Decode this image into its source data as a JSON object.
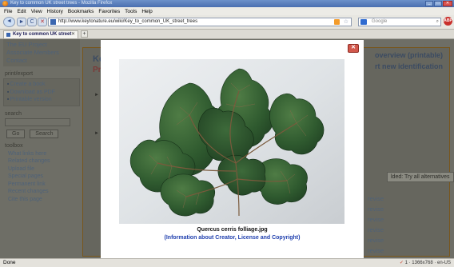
{
  "window": {
    "title": "Key to common UK street trees - Mozilla Firefox",
    "buttons": [
      "_",
      "□",
      "✕"
    ]
  },
  "menu": [
    "File",
    "Edit",
    "View",
    "History",
    "Bookmarks",
    "Favorites",
    "Tools",
    "Help"
  ],
  "nav": {
    "back": "◄",
    "forward": "►",
    "reload": "C",
    "stop": "✕",
    "home": "⌂",
    "url": "http://www.keytonature.eu/wiki/Key_to_common_UK_street_trees",
    "search_placeholder": "Google",
    "search_icon": "⌕",
    "addon_label": "ABP"
  },
  "tabs": [
    {
      "label": "Key to common UK street tr...",
      "close": "✕"
    }
  ],
  "newtab": "+",
  "sidebar": {
    "top_links": [
      "The EU Project",
      "Associate Members",
      "Contact"
    ],
    "print_heading": "print/export",
    "print_links": [
      "Create a book",
      "Download as PDF",
      "Printable version"
    ],
    "search_heading": "search",
    "go": "Go",
    "search_btn": "Search",
    "toolbox_heading": "toolbox",
    "toolbox_links": [
      "What links here",
      "Related changes",
      "Upload file",
      "Special pages",
      "Permanent link",
      "Recent changes",
      "Cite this page"
    ]
  },
  "content": {
    "title": "Ke",
    "subtitle": "Pr",
    "right1": "overview (printable)",
    "right2": "rt new identification",
    "arrow": "►",
    "pill": "lded: Try all alternatives",
    "revise": [
      "revise",
      "revise",
      "revise",
      "revise",
      "revise",
      "revise"
    ]
  },
  "lightbox": {
    "close": "✕",
    "caption": "Quercus cerris folliage.jpg",
    "credit": "(Information about Creator, License and Copyright)"
  },
  "status": {
    "left": "Done",
    "right": "1 · 1366x768 · en-US"
  },
  "colors": {
    "accent": "#1f3fae",
    "leaf": "#2c5a2e",
    "overlay": "#6e6e66"
  }
}
